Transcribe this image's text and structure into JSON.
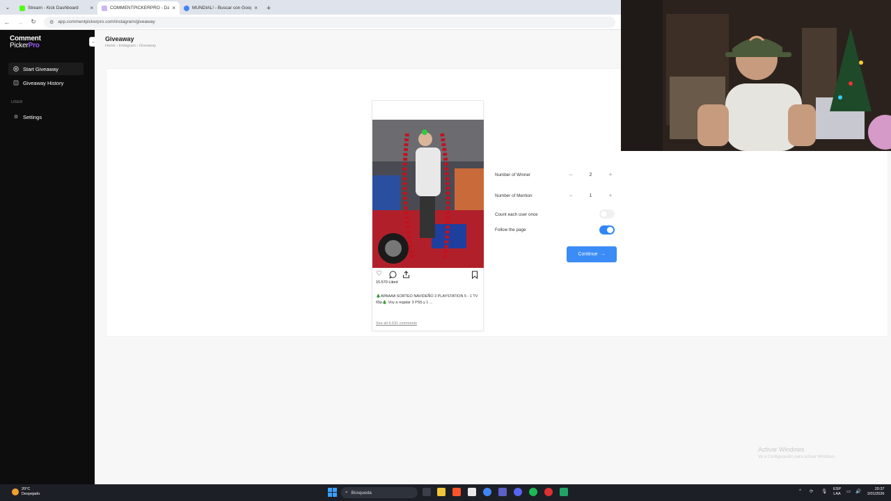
{
  "browser": {
    "tabs": [
      {
        "title": "Stream - Kick Dashboard",
        "color": "#53fc18",
        "active": false
      },
      {
        "title": "COMMENTPICKERPRO - Dashb",
        "color": "#c9b8f5",
        "active": true
      },
      {
        "title": "MUNDIAL! - Buscar con Google",
        "color": "#4285f4",
        "active": false
      }
    ],
    "url": "app.commentpickerpro.com/instagram/giveaway"
  },
  "sidebar": {
    "logo_line1": "Comment",
    "logo_line2a": "Picker",
    "logo_line2b": "Pro",
    "items": [
      {
        "label": "Start Giveaway"
      },
      {
        "label": "Giveaway History"
      }
    ],
    "section_label": "USER",
    "settings_label": "Settings"
  },
  "header": {
    "title": "Giveaway",
    "breadcrumb": "Home  ›  Instagram  ›  Giveaway"
  },
  "post": {
    "likes": "15.570 Liked",
    "caption": "🎄APAAAA SORTEO NAVIDEÑO 3 PLAYSTATION 5 - 1 TV 65p🎄 Voy a regalar 3 PS5 y 1 ...",
    "see_all": "See all 6.631 comments"
  },
  "settings": {
    "winners_label": "Number of Winner",
    "winners_value": "2",
    "mention_label": "Number of Mention",
    "mention_value": "1",
    "count_once_label": "Count each user once",
    "count_once": false,
    "follow_label": "Follow the page",
    "follow": true,
    "continue_label": "Continue"
  },
  "watermark": {
    "line1": "Activar Windows",
    "line2": "Ve a Configuración para activar Windows."
  },
  "taskbar": {
    "temp": "20°C",
    "weather": "Despejado",
    "search_placeholder": "Búsqueda",
    "lang1": "ESP",
    "lang2": "LAA",
    "time": "20:37",
    "date": "2/01/2026"
  },
  "colors": {
    "accent": "#3b8cf6",
    "brand_purple": "#9b5cf6",
    "sidebar_bg": "#0d0d0d"
  }
}
